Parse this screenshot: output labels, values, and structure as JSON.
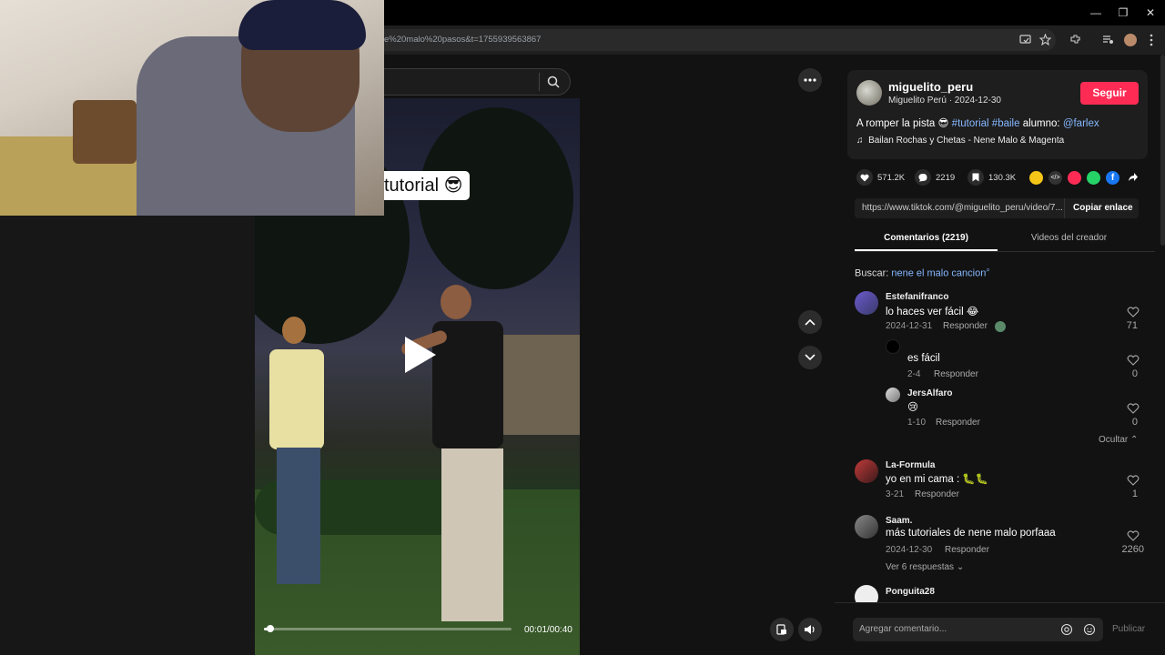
{
  "browser": {
    "url": "e%20malo%20pasos&t=1755939563867"
  },
  "video": {
    "caption": "tutorial 😎",
    "time": "00:01/00:40",
    "progress": 0.025
  },
  "author": {
    "username": "miguelito_peru",
    "display_date": "Miguelito Perú · 2024-12-30",
    "follow_label": "Seguir",
    "description_prefix": "A romper la pista 😎 ",
    "tag1": "#tutorial",
    "tag2": "#baile",
    "desc_mid": " alumno: ",
    "mention": "@farlex",
    "music": "Bailan Rochas y Chetas - Nene Malo & Magenta"
  },
  "stats": {
    "likes": "571.2K",
    "comments": "2219",
    "saves": "130.3K"
  },
  "link": {
    "url": "https://www.tiktok.com/@miguelito_peru/video/7...",
    "copy_label": "Copiar enlace"
  },
  "tabs": {
    "comments": "Comentarios (2219)",
    "videos": "Videos del creador"
  },
  "search": {
    "prefix": "Buscar: ",
    "query": "nene el malo cancion"
  },
  "comments": [
    {
      "name": "Estefanifranco",
      "text": "lo haces ver fácil 😂",
      "date": "2024-12-31",
      "reply": "Responder",
      "likes": "71"
    },
    {
      "name": "",
      "text": "es fácil",
      "date": "2-4",
      "reply": "Responder",
      "likes": "0"
    },
    {
      "name": "JersAlfaro",
      "text": "😢",
      "date": "1-10",
      "reply": "Responder",
      "likes": "0"
    },
    {
      "name": "La-Formula",
      "text": "yo en mi cama : 🐛🐛",
      "date": "3-21",
      "reply": "Responder",
      "likes": "1"
    },
    {
      "name": "Saam.",
      "text": "más tutoriales de nene malo porfaaa",
      "date": "2024-12-30",
      "reply": "Responder",
      "likes": "2260"
    },
    {
      "name": "Ponguita28",
      "text": "",
      "date": "",
      "reply": "",
      "likes": ""
    }
  ],
  "thread": {
    "hide_label": "Ocultar",
    "more_replies": "Ver 6 respuestas"
  },
  "composer": {
    "placeholder": "Agregar comentario...",
    "publish": "Publicar"
  },
  "colors": {
    "accent": "#fe2c55",
    "link": "#86b8ff",
    "background": "#121212"
  }
}
